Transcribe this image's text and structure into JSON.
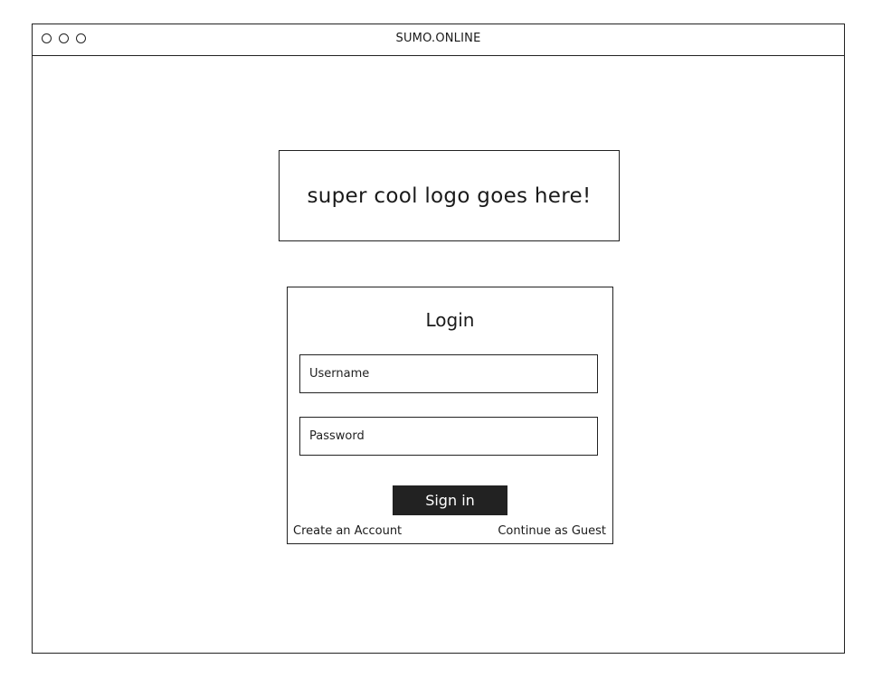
{
  "window": {
    "title": "SUMO.ONLINE"
  },
  "logo": {
    "text": "super cool logo goes here!"
  },
  "login": {
    "title": "Login",
    "username_placeholder": "Username",
    "password_placeholder": "Password",
    "signin_label": "Sign in",
    "create_account_label": "Create an Account",
    "guest_label": "Continue as Guest"
  }
}
